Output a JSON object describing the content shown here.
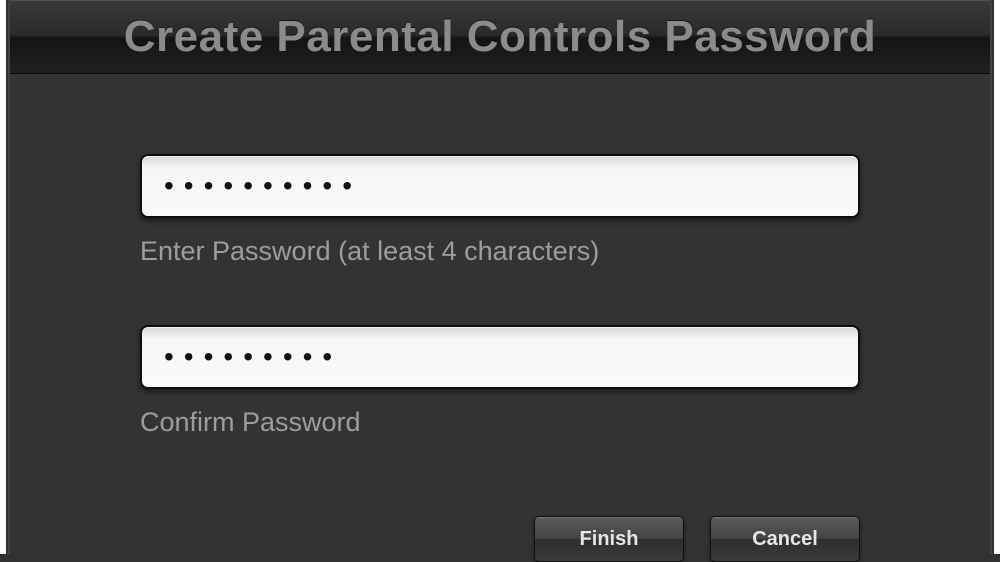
{
  "dialog": {
    "title": "Create Parental Controls Password"
  },
  "fields": {
    "password": {
      "value": "••••••••••",
      "label": "Enter Password (at least 4 characters)"
    },
    "confirm": {
      "value": "•••••••••",
      "label": "Confirm Password"
    }
  },
  "buttons": {
    "primary": "Finish",
    "secondary": "Cancel"
  }
}
